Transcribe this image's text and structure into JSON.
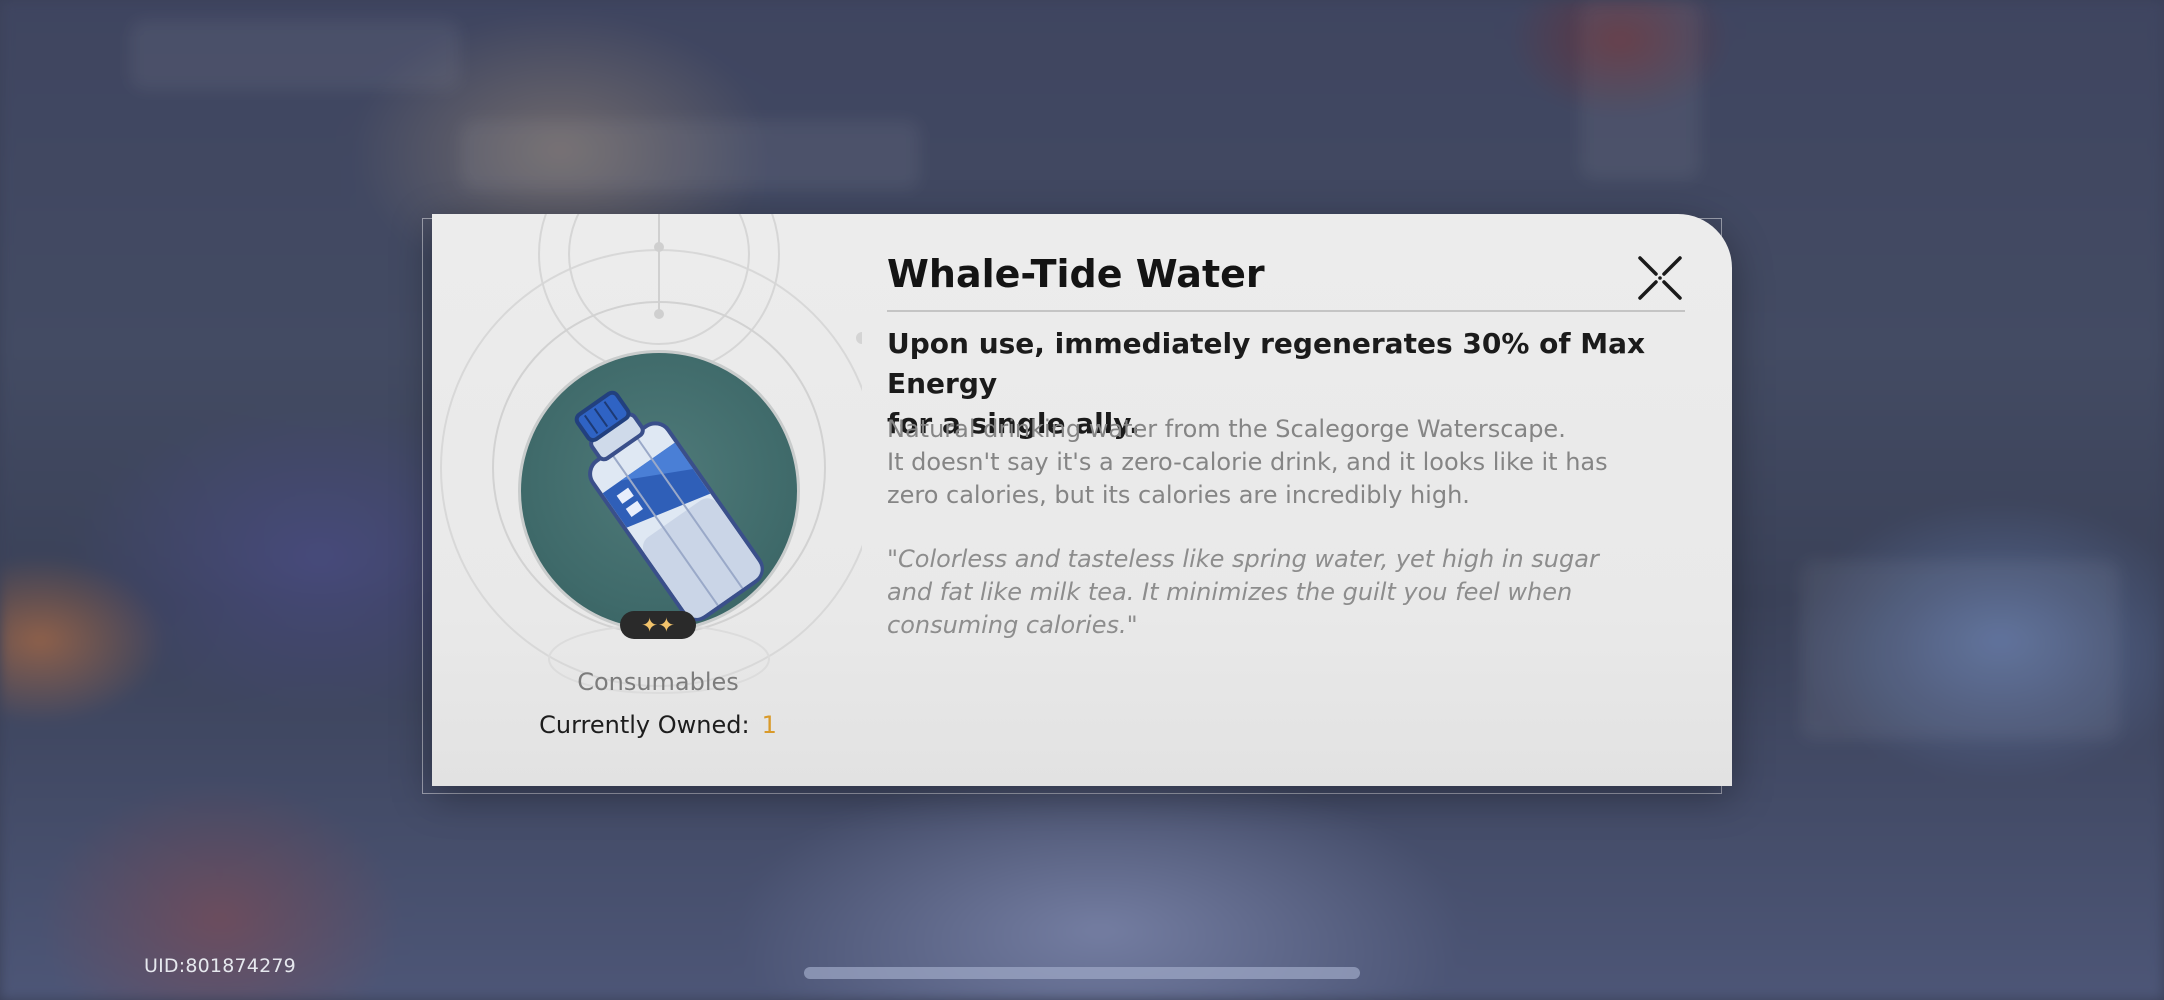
{
  "item": {
    "name": "Whale-Tide Water",
    "effect_line1": "Upon use, immediately regenerates 30% of Max Energy",
    "effect_line2": "for a single ally.",
    "description_line1": "Natural drinking water from the Scalegorge Waterscape.",
    "description_line2": "It doesn't say it's a zero-calorie drink, and it looks like it has",
    "description_line3": "zero calories, but its calories are incredibly high.",
    "quote_line1": "\"Colorless and tasteless like spring water, yet high in sugar",
    "quote_line2": "and fat like milk tea. It minimizes the guilt you feel when",
    "quote_line3": "consuming calories.\"",
    "rarity_stars": "✦✦",
    "rarity": 2,
    "category": "Consumables",
    "owned_label": "Currently Owned:",
    "owned_count": "1",
    "icon": "water-bottle-icon"
  },
  "footer": {
    "uid": "UID:801874279"
  },
  "colors": {
    "accent_count": "#d99a2a",
    "art_background": "#3f6a6a",
    "dialog_background": "#ececec",
    "star_color": "#f2c36b"
  },
  "icons": {
    "close": "close-x-icon",
    "stars": "star-icon"
  }
}
